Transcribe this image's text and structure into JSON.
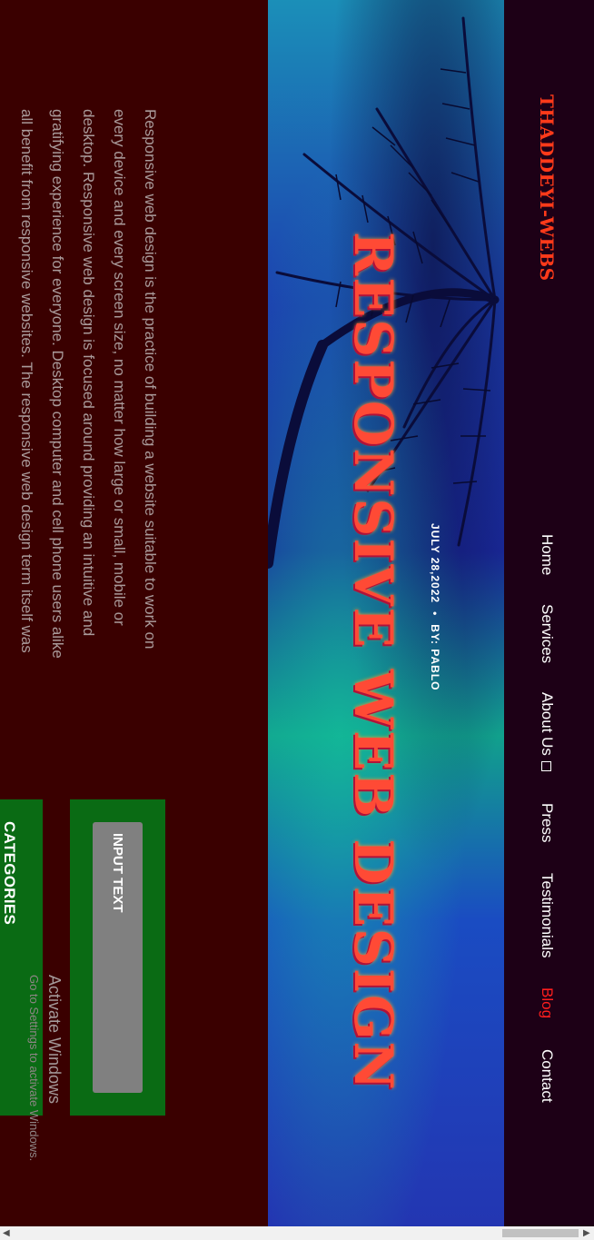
{
  "site": {
    "logo": "THADDEYI-WEBS"
  },
  "nav": {
    "items": [
      {
        "label": "Home"
      },
      {
        "label": "Services"
      },
      {
        "label": "About Us"
      },
      {
        "label": "Press"
      },
      {
        "label": "Testimonials"
      },
      {
        "label": "Blog"
      },
      {
        "label": "Contact"
      }
    ],
    "active_color": "#ff1e1e"
  },
  "hero": {
    "title": "RESPONSIVE WEB DESIGN",
    "date": "JULY 28,2022",
    "separator": "•",
    "author": "BY: PABLO"
  },
  "article": {
    "lines": [
      "Responsive web design is the practice of building a website suitable to work on",
      "every device and every screen size, no matter how large or small, mobile or",
      "desktop. Responsive web design is focused around providing an intuitive and",
      "gratifying experience for everyone. Desktop computer and cell phone users alike",
      "all benefit from responsive websites. The responsive web design term itself was"
    ]
  },
  "sidebar": {
    "search_label": "INPUT TEXT",
    "categories_title": "CATEGORIES"
  },
  "watermark": {
    "title": "Activate Windows",
    "subtitle": "Go to Settings to activate Windows."
  },
  "scrollbar": {
    "left_arrow": "◀",
    "right_arrow": "▶"
  },
  "colors": {
    "background": "#3a0000",
    "nav_bg": "#1d0016",
    "logo": "#ff3a1a",
    "hero_title": "#ff4a35",
    "widget_green": "#0a6b14",
    "input_gray": "#808080"
  }
}
